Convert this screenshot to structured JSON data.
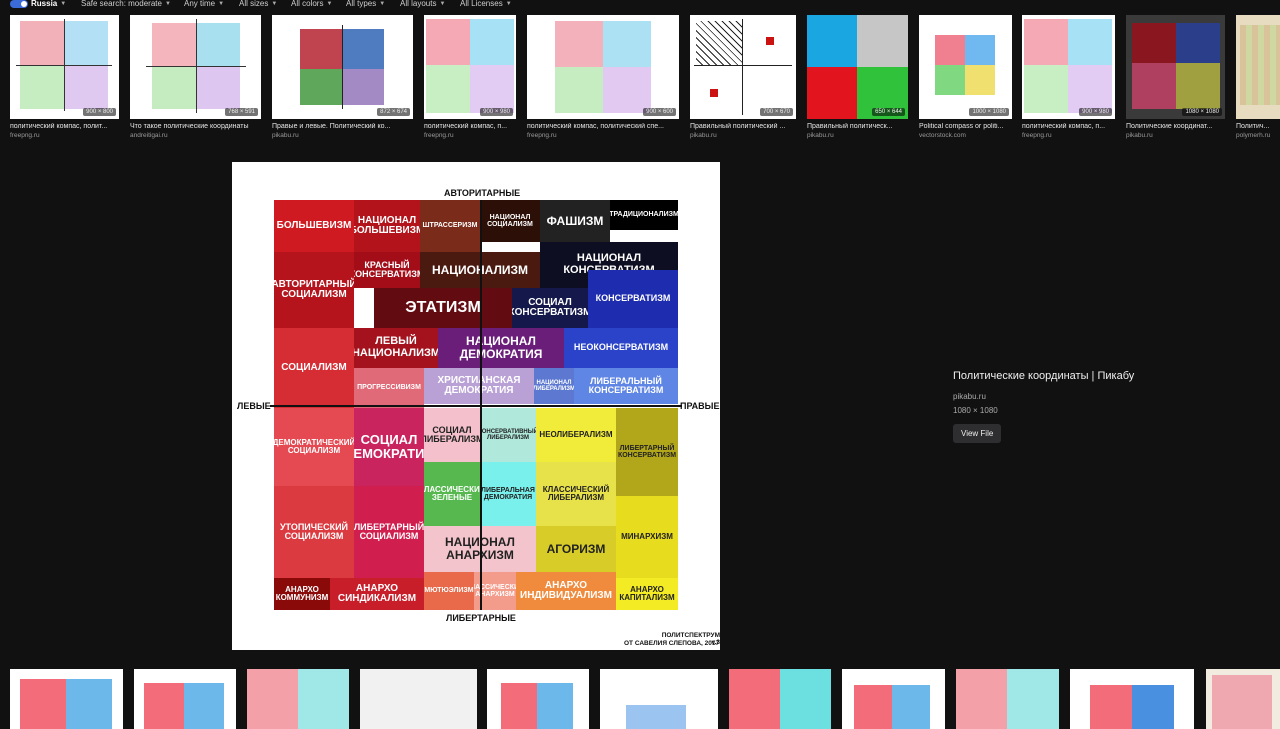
{
  "filters": {
    "region": "Russia",
    "safe_search": "Safe search: moderate",
    "time": "Any time",
    "sizes": "All sizes",
    "colors": "All colors",
    "types": "All types",
    "layouts": "All layouts",
    "licenses": "All Licenses"
  },
  "thumbnails": [
    {
      "caption": "политический компас, полит...",
      "source": "freepng.ru",
      "dims": "900 × 800"
    },
    {
      "caption": "Что такое политические координаты",
      "source": "andreitigai.ru",
      "dims": "768 × 591"
    },
    {
      "caption": "Правые и левые. Политический ко...",
      "source": "pikabu.ru",
      "dims": "872 × 674"
    },
    {
      "caption": "политический компас, п...",
      "source": "freepng.ru",
      "dims": "900 × 980"
    },
    {
      "caption": "политический компас, политический спе...",
      "source": "freepng.ru",
      "dims": "900 × 600"
    },
    {
      "caption": "Правильный политический ...",
      "source": "pikabu.ru",
      "dims": "700 × 670"
    },
    {
      "caption": "Правильный политическ...",
      "source": "pikabu.ru",
      "dims": "650 × 644"
    },
    {
      "caption": "Political compass or politi...",
      "source": "vectorstock.com",
      "dims": "1000 × 1080"
    },
    {
      "caption": "политический компас, п...",
      "source": "freepng.ru",
      "dims": "900 × 980"
    },
    {
      "caption": "Политические координат...",
      "source": "pikabu.ru",
      "dims": "1080 × 1080"
    },
    {
      "caption": "Политич...",
      "source": "polymerh.ru",
      "dims": ""
    }
  ],
  "viewer": {
    "top_label": "АВТОРИТАРНЫЕ",
    "bottom_label": "ЛИБЕРТАРНЫЕ",
    "left_label": "ЛЕВЫЕ",
    "right_label": "ПРАВЫЕ",
    "credit_line1": "ПОЛИТСПЕКТРУМ v.3",
    "credit_line2": "ОТ САВЕЛИЯ СЛЕПОВА, 2017",
    "cells": [
      {
        "t": "БОЛЬШЕВИЗМ"
      },
      {
        "t": "НАЦИОНАЛ БОЛЬШЕВИЗМ"
      },
      {
        "t": "ШТРАССЕРИЗМ"
      },
      {
        "t": "НАЦИОНАЛ СОЦИАЛИЗМ"
      },
      {
        "t": "ФАШИЗМ"
      },
      {
        "t": "ТРАДИЦИОНАЛИЗМ"
      },
      {
        "t": "КРАСНЫЙ КОНСЕРВАТИЗМ"
      },
      {
        "t": "НАЦИОНАЛИЗМ"
      },
      {
        "t": "НАЦИОНАЛ КОНСЕРВАТИЗМ"
      },
      {
        "t": "АВТОРИТАРНЫЙ СОЦИАЛИЗМ"
      },
      {
        "t": "ЭТАТИЗМ"
      },
      {
        "t": "СОЦИАЛ КОНСЕРВАТИЗМ"
      },
      {
        "t": "КОНСЕРВАТИЗМ"
      },
      {
        "t": "СОЦИАЛИЗМ"
      },
      {
        "t": "ЛЕВЫЙ НАЦИОНАЛИЗМ"
      },
      {
        "t": "НАЦИОНАЛ ДЕМОКРАТИЯ"
      },
      {
        "t": "НЕОКОНСЕРВАТИЗМ"
      },
      {
        "t": "ПРОГРЕССИВИЗМ"
      },
      {
        "t": "ХРИСТИАНСКАЯ ДЕМОКРАТИЯ"
      },
      {
        "t": "НАЦИОНАЛ ЛИБЕРАЛИЗМ"
      },
      {
        "t": "ЛИБЕРАЛЬНЫЙ КОНСЕРВАТИЗМ"
      },
      {
        "t": "ДЕМОКРАТИЧЕСКИЙ СОЦИАЛИЗМ"
      },
      {
        "t": "СОЦИАЛ ДЕМОКРАТИЯ"
      },
      {
        "t": "СОЦИАЛ ЛИБЕРАЛИЗМ"
      },
      {
        "t": "КОНСЕРВАТИВНЫЙ ЛИБЕРАЛИЗМ"
      },
      {
        "t": "НЕОЛИБЕРАЛИЗМ"
      },
      {
        "t": "ЛИБЕРТАРНЫЙ КОНСЕРВАТИЗМ"
      },
      {
        "t": "КЛАССИЧЕСКИЕ ЗЕЛЕНЫЕ"
      },
      {
        "t": "ЛИБЕРАЛЬНАЯ ДЕМОКРАТИЯ"
      },
      {
        "t": "КЛАССИЧЕСКИЙ ЛИБЕРАЛИЗМ"
      },
      {
        "t": "УТОПИЧЕСКИЙ СОЦИАЛИЗМ"
      },
      {
        "t": "ЛИБЕРТАРНЫЙ СОЦИАЛИЗМ"
      },
      {
        "t": "МИНАРХИЗМ"
      },
      {
        "t": "НАЦИОНАЛ АНАРХИЗМ"
      },
      {
        "t": "АГОРИЗМ"
      },
      {
        "t": "АНАРХО КОММУНИЗМ"
      },
      {
        "t": "АНАРХО СИНДИКАЛИЗМ"
      },
      {
        "t": "МЮТЮЭЛИЗМ"
      },
      {
        "t": "КЛАССИЧЕСКИЙ АНАРХИЗМ"
      },
      {
        "t": "АНАРХО ИНДИВИДУАЛИЗМ"
      },
      {
        "t": "АНАРХО КАПИТАЛИЗМ"
      }
    ]
  },
  "details": {
    "title": "Политические координаты | Пикабу",
    "source": "pikabu.ru",
    "dims": "1080 × 1080",
    "view_file": "View File"
  },
  "colors": {
    "background": "#111112",
    "toggle": "#3b6bd6"
  }
}
